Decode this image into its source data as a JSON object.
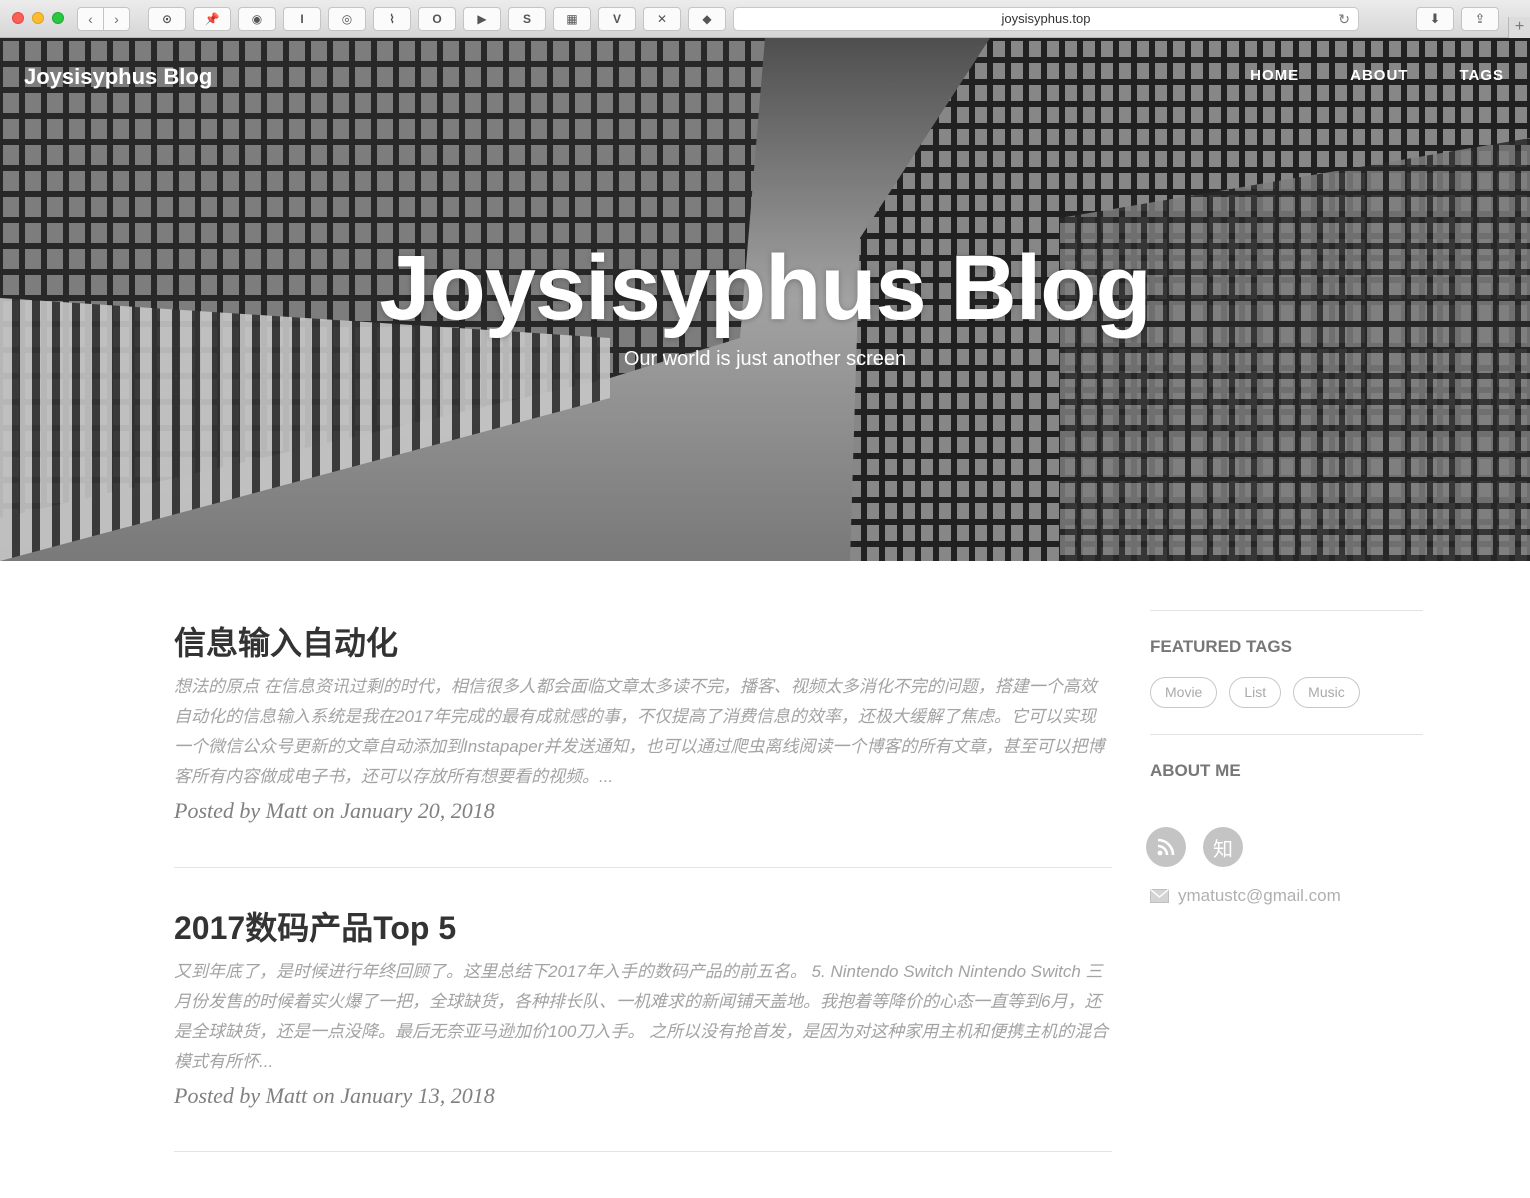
{
  "browser": {
    "url": "joysisyphus.top",
    "extensions": [
      "toggle-icon",
      "pin-icon",
      "globe-icon",
      "cursor-icon",
      "swirl-icon",
      "rss-icon",
      "opera-icon",
      "play-icon",
      "s-icon",
      "image-icon",
      "v-icon",
      "x-icon",
      "evernote-icon"
    ],
    "ext_glyphs": [
      "⊙",
      "📌",
      "◉",
      "I",
      "◎",
      "⌇",
      "O",
      "▶",
      "S",
      "▦",
      "V",
      "✕",
      "◆"
    ]
  },
  "site": {
    "brand": "Joysisyphus Blog",
    "nav": {
      "home": "HOME",
      "about": "ABOUT",
      "tags": "TAGS"
    },
    "hero_title": "Joysisyphus Blog",
    "hero_subtitle": "Our world is just another screen"
  },
  "posts": [
    {
      "title": "信息输入自动化",
      "excerpt": "想法的原点 在信息资讯过剩的时代，相信很多人都会面临文章太多读不完，播客、视频太多消化不完的问题，搭建一个高效自动化的信息输入系统是我在2017年完成的最有成就感的事，不仅提高了消费信息的效率，还极大缓解了焦虑。它可以实现一个微信公众号更新的文章自动添加到Instapaper并发送通知，也可以通过爬虫离线阅读一个博客的所有文章，甚至可以把博客所有内容做成电子书，还可以存放所有想要看的视频。...",
      "meta": "Posted by Matt on January 20, 2018"
    },
    {
      "title": "2017数码产品Top 5",
      "excerpt": "又到年底了，是时候进行年终回顾了。这里总结下2017年入手的数码产品的前五名。 5. Nintendo Switch Nintendo Switch 三月份发售的时候着实火爆了一把，全球缺货，各种排长队、一机难求的新闻铺天盖地。我抱着等降价的心态一直等到6月，还是全球缺货，还是一点没降。最后无奈亚马逊加价100刀入手。 之所以没有抢首发，是因为对这种家用主机和便携主机的混合模式有所怀...",
      "meta": "Posted by Matt on January 13, 2018"
    }
  ],
  "sidebar": {
    "featured_tags_title": "FEATURED TAGS",
    "tags": [
      "Movie",
      "List",
      "Music"
    ],
    "about_title": "ABOUT ME",
    "social": {
      "zhihu": "知"
    },
    "email": "ymatustc@gmail.com"
  }
}
